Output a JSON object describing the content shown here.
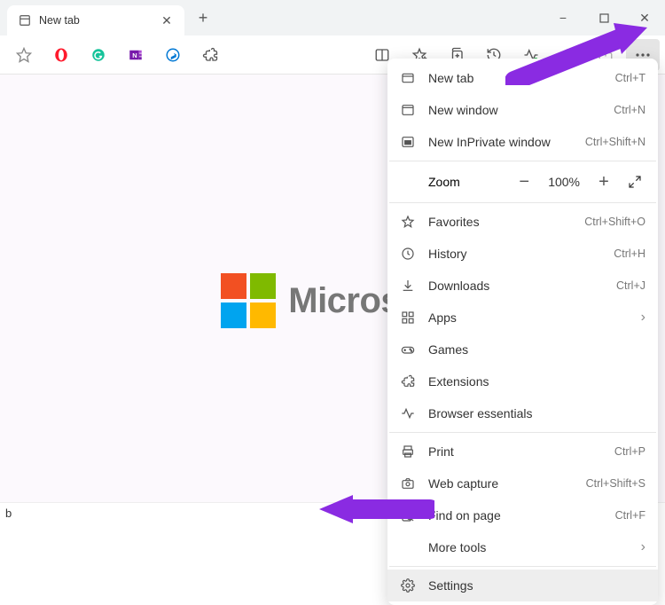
{
  "tab": {
    "title": "New tab"
  },
  "window_controls": {
    "minimize": "−",
    "maximize": "□",
    "close": "✕"
  },
  "toolbar_icons": [
    "favorite-icon",
    "opera-icon",
    "grammarly-icon",
    "onenote-icon",
    "bing-icon",
    "extensions-icon",
    "reader-icon",
    "favorites-icon",
    "collections-icon",
    "history-icon",
    "browser-essentials-icon",
    "web-capture-icon",
    "share-icon",
    "more-icon"
  ],
  "menu": {
    "new_tab": {
      "label": "New tab",
      "shortcut": "Ctrl+T"
    },
    "new_window": {
      "label": "New window",
      "shortcut": "Ctrl+N"
    },
    "new_inprivate": {
      "label": "New InPrivate window",
      "shortcut": "Ctrl+Shift+N"
    },
    "zoom": {
      "label": "Zoom",
      "value": "100%"
    },
    "favorites": {
      "label": "Favorites",
      "shortcut": "Ctrl+Shift+O"
    },
    "history": {
      "label": "History",
      "shortcut": "Ctrl+H"
    },
    "downloads": {
      "label": "Downloads",
      "shortcut": "Ctrl+J"
    },
    "apps": {
      "label": "Apps"
    },
    "games": {
      "label": "Games"
    },
    "extensions": {
      "label": "Extensions"
    },
    "essentials": {
      "label": "Browser essentials"
    },
    "print": {
      "label": "Print",
      "shortcut": "Ctrl+P"
    },
    "capture": {
      "label": "Web capture",
      "shortcut": "Ctrl+Shift+S"
    },
    "find": {
      "label": "Find on page",
      "shortcut": "Ctrl+F"
    },
    "more_tools": {
      "label": "More tools"
    },
    "settings": {
      "label": "Settings"
    }
  },
  "content": {
    "brand": "Microsoft",
    "bottom_letter": "b"
  }
}
